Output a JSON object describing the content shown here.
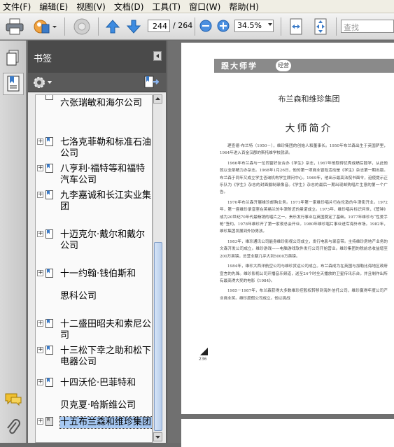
{
  "menu": [
    "文件(F)",
    "编辑(E)",
    "视图(V)",
    "文档(D)",
    "工具(T)",
    "窗口(W)",
    "帮助(H)"
  ],
  "toolbar": {
    "current_page": "244",
    "page_total": "/ 264",
    "zoom": "34.5%",
    "search_placeholder": "查找"
  },
  "bookmarks": {
    "title": "书签",
    "items": [
      {
        "label": "六张瑞敏和海尔公司",
        "expandable": false
      },
      {
        "label": "七洛克菲勒和标准石油公司",
        "expandable": true
      },
      {
        "label": "八亨利·福特等和福特汽车公司",
        "expandable": true
      },
      {
        "label": "九李嘉诚和长江实业集团",
        "expandable": true
      },
      {
        "label": "十迈克尔·戴尔和戴尔公司",
        "expandable": true
      },
      {
        "label": "十一约翰·钱伯斯和",
        "expandable": true
      },
      {
        "label": "思科公司",
        "expandable": false
      },
      {
        "label": "十二盛田昭夫和索尼公司",
        "expandable": true
      },
      {
        "label": "十三松下幸之助和松下电器公司",
        "expandable": true
      },
      {
        "label": "十四沃伦·巴菲特和",
        "expandable": true
      },
      {
        "label": "贝克夏·哈斯维公司",
        "expandable": false
      },
      {
        "label": "十五布兰森和维珍集团",
        "expandable": true,
        "selected": true
      }
    ]
  },
  "page": {
    "header_text": "跟大师学",
    "header_badge": "经营",
    "section_title": "布兰森和维珍集团",
    "heading": "大师简介",
    "paragraphs": [
      "理查德·布兰特（1950－），维珍集团的创始人和董事长。1950年布兰森出生于英国萨里，1964年进入百金汉郡的斯托维学校就读。",
      "1966年布兰森与一位同窗好友合办《学生》杂志，1967年他取得优秀成绩后毅学，从此他就以全部精力办杂志。1968年1月26日，他的第一项商业冒险活动是《学生》杂志第一期出版。布兰森于同年又成立学生咨询机构学生顾问中心。1969年，他出示最高法院书面令，迫使提示正乐队为《学生》杂志的封面摄制录像音。《学生》杂志的最后一期出现邮购唱片生意的第一个广告。",
      "1970年布兰森开展维珍邮购业务。1971年第一家维珍唱片行在伦敦的牛津街开业。1972年，第一座维珍录音室在英格兰的牛津附近的曼诺成立。1973年，维珍唱片标识问世，《管钟》成为20世纪70年代最畅销的唱片之一。贵乐发行事业在英国奠定了基础。1977年维珍与“性爱手枪”签约。1978年维珍开了第一家夜总会开业。1980年维珍唱片事业进军海外市场。1982年，维珍集团发展到外协男孩。",
      "1983年，维珍通讯公司能身维珍影视公司成立，发行电影与录音带。主持维珍房地产业务的文森开发公司成立。维珍游戏——电脑游戏软件发行公司开始营业。维珍集团的税前总收益增至200万英镑，总营业额几乎大到5000万英镑。",
      "1984年，维珍大西洋航空公司与维珍货运公司成立。布兰森成为在英国与加勒比海地区政府宣言的先锋。维珍影视公司开播音乐频道，送至24个时全天播放的卫星传讯乐台，并且制作出所有最高得大奖的电影《1984》。",
      "1985－1987年，布兰森获得大多数维珍控股权转移到海外信托公司，维珍赢得年度公司产业商业奖。维珍度假公司成立。他以挑战"
    ],
    "page_number": "236"
  }
}
